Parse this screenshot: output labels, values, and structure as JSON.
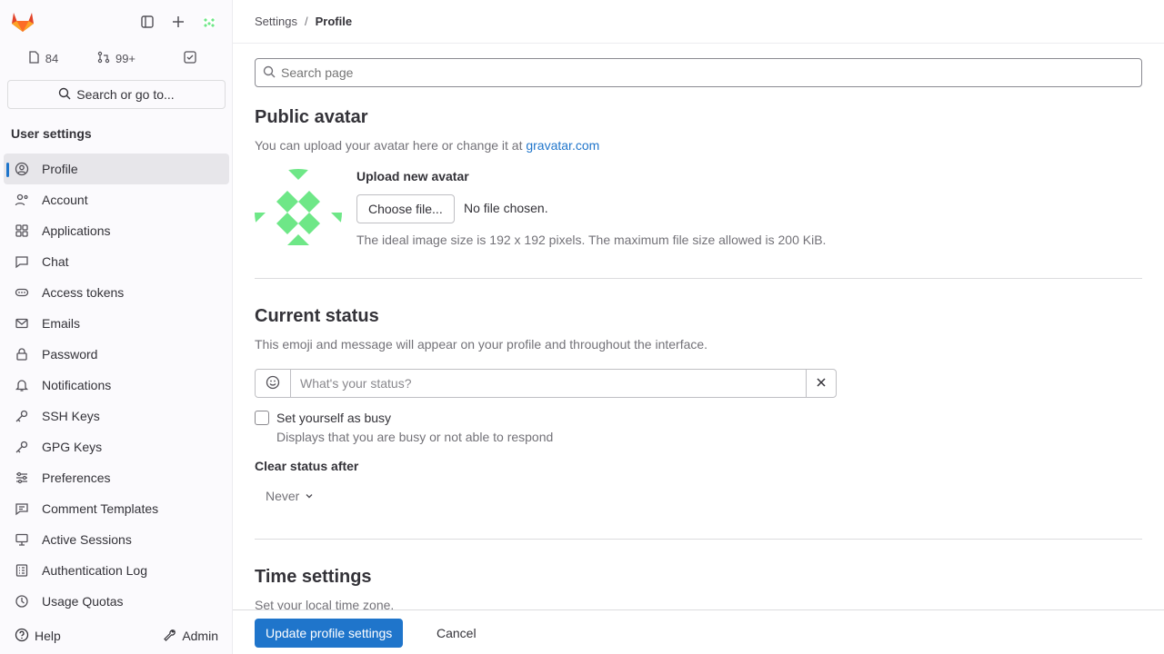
{
  "sidebar": {
    "counters": [
      {
        "icon": "issues-icon",
        "value": "84"
      },
      {
        "icon": "merge-request-icon",
        "value": "99+"
      },
      {
        "icon": "todo-icon",
        "value": ""
      }
    ],
    "search_label": "Search or go to...",
    "section_title": "User settings",
    "items": [
      {
        "label": "Profile",
        "icon": "profile-icon"
      },
      {
        "label": "Account",
        "icon": "account-icon"
      },
      {
        "label": "Applications",
        "icon": "applications-icon"
      },
      {
        "label": "Chat",
        "icon": "chat-icon"
      },
      {
        "label": "Access tokens",
        "icon": "token-icon"
      },
      {
        "label": "Emails",
        "icon": "mail-icon"
      },
      {
        "label": "Password",
        "icon": "lock-icon"
      },
      {
        "label": "Notifications",
        "icon": "bell-icon"
      },
      {
        "label": "SSH Keys",
        "icon": "key-icon"
      },
      {
        "label": "GPG Keys",
        "icon": "key-icon"
      },
      {
        "label": "Preferences",
        "icon": "preferences-icon"
      },
      {
        "label": "Comment Templates",
        "icon": "comment-icon"
      },
      {
        "label": "Active Sessions",
        "icon": "monitor-icon"
      },
      {
        "label": "Authentication Log",
        "icon": "log-icon"
      },
      {
        "label": "Usage Quotas",
        "icon": "quota-icon"
      }
    ],
    "help_label": "Help",
    "admin_label": "Admin"
  },
  "breadcrumb": {
    "parent": "Settings",
    "sep": "/",
    "current": "Profile"
  },
  "search_page": {
    "placeholder": "Search page"
  },
  "avatar_section": {
    "title": "Public avatar",
    "desc_prefix": "You can upload your avatar here or change it at ",
    "desc_link": "gravatar.com",
    "upload_title": "Upload new avatar",
    "choose_label": "Choose file...",
    "no_file": "No file chosen.",
    "hint": "The ideal image size is 192 x 192 pixels. The maximum file size allowed is 200 KiB."
  },
  "status_section": {
    "title": "Current status",
    "desc": "This emoji and message will appear on your profile and throughout the interface.",
    "placeholder": "What's your status?",
    "busy_label": "Set yourself as busy",
    "busy_help": "Displays that you are busy or not able to respond",
    "clear_after_label": "Clear status after",
    "clear_after_value": "Never"
  },
  "time_section": {
    "title": "Time settings",
    "desc": "Set your local time zone."
  },
  "footer": {
    "update_label": "Update profile settings",
    "cancel_label": "Cancel"
  },
  "colors": {
    "primary": "#1f75cb",
    "avatar_green": "#6ee787"
  }
}
